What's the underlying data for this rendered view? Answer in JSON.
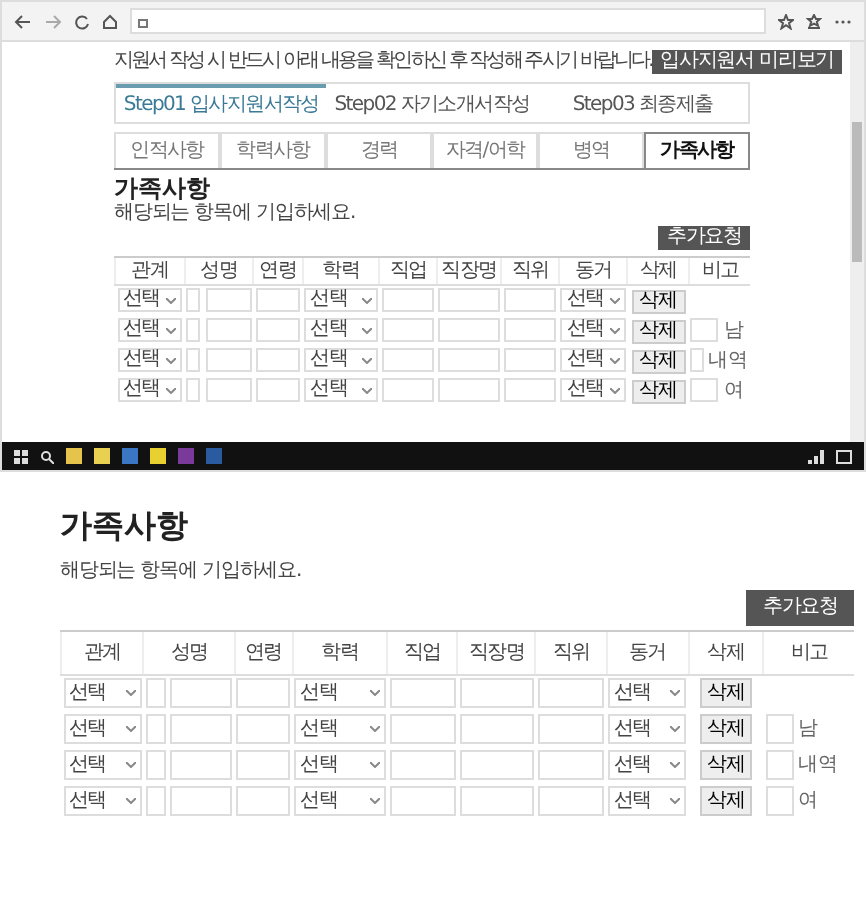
{
  "browser": {
    "notice": "지원서 작성 시 반드시 아래 내용을 확인하신 후 작성해 주시기 바랍니다.",
    "notice_button": "입사지원서 미리보기",
    "steps": [
      {
        "label": "Step01 입사지원서작성",
        "selected": true
      },
      {
        "label": "Step02 자기소개서작성",
        "selected": false
      },
      {
        "label": "Step03 최종제출",
        "selected": false
      }
    ],
    "subtabs": [
      {
        "label": "인적사항",
        "selected": false
      },
      {
        "label": "학력사항",
        "selected": false
      },
      {
        "label": "경력",
        "selected": false
      },
      {
        "label": "자격/어학",
        "selected": false
      },
      {
        "label": "병역",
        "selected": false
      },
      {
        "label": "가족사항",
        "selected": true
      }
    ],
    "section": {
      "title": "가족사항",
      "hint": "해당되는 항목에 기입하세요.",
      "button": "추가요청",
      "columns": [
        "관계",
        "성명",
        "연령",
        "학력",
        "직업",
        "직장명",
        "직위",
        "동거",
        "삭제",
        "비고"
      ],
      "rows": [
        {
          "relation": "선택",
          "education": "선택",
          "cohabit": "선택",
          "delete": "삭제"
        },
        {
          "relation": "선택",
          "education": "선택",
          "cohabit": "선택",
          "delete": "삭제"
        },
        {
          "relation": "선택",
          "education": "선택",
          "cohabit": "선택",
          "delete": "삭제"
        },
        {
          "relation": "선택",
          "education": "선택",
          "cohabit": "선택",
          "delete": "삭제"
        }
      ],
      "side_labels": [
        "남",
        "내역",
        "여"
      ]
    }
  },
  "zoomed": {
    "title": "가족사항",
    "hint": "해당되는 항목에 기입하세요.",
    "button": "추가요청",
    "columns": [
      "관계",
      "성명",
      "연령",
      "학력",
      "직업",
      "직장명",
      "직위",
      "동거",
      "삭제",
      "비고"
    ],
    "rows": [
      {
        "relation": "선택",
        "education": "선택",
        "cohabit": "선택",
        "delete": "삭제"
      },
      {
        "relation": "선택",
        "education": "선택",
        "cohabit": "선택",
        "delete": "삭제"
      },
      {
        "relation": "선택",
        "education": "선택",
        "cohabit": "선택",
        "delete": "삭제"
      },
      {
        "relation": "선택",
        "education": "선택",
        "cohabit": "선택",
        "delete": "삭제"
      }
    ],
    "side_labels": [
      "남",
      "내역",
      "여"
    ]
  }
}
